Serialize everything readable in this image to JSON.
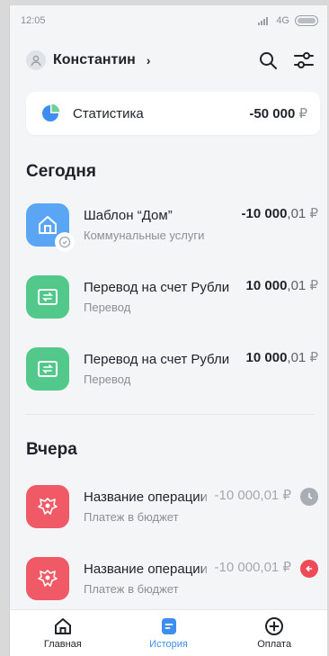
{
  "status_bar": {
    "time": "12:05",
    "network": "4G"
  },
  "header": {
    "user_name": "Константин",
    "chevron": "›"
  },
  "stats": {
    "label": "Статистика",
    "amount": "-50 000",
    "currency": "₽"
  },
  "sections": {
    "today": "Сегодня",
    "yesterday": "Вчера"
  },
  "transactions_today": [
    {
      "title": "Шаблон “Дом”",
      "subtitle": "Коммунальные услуги",
      "amount_int": "-10 000",
      "amount_frac": ",01",
      "currency": "₽",
      "icon": "house-icon",
      "badge": "clock-badge-icon",
      "color": "#5aa6f5"
    },
    {
      "title": "Перевод на счет Рубли",
      "subtitle": "Перевод",
      "amount_int": "10 000",
      "amount_frac": ",01",
      "currency": "₽",
      "icon": "transfer-icon",
      "color": "#52c98a"
    },
    {
      "title": "Перевод на счет Рубли",
      "subtitle": "Перевод",
      "amount_int": "10 000",
      "amount_frac": ",01",
      "currency": "₽",
      "icon": "transfer-icon",
      "color": "#52c98a"
    }
  ],
  "transactions_yesterday": [
    {
      "title": "Название операции",
      "subtitle": "Платеж в бюджет",
      "amount_int": "-10 000",
      "amount_frac": ",01",
      "currency": "₽",
      "icon": "eagle-emblem-icon",
      "status": "clock-status-icon",
      "color": "#ef5a66",
      "status_color": "#a9aeb4"
    },
    {
      "title": "Название операции",
      "subtitle": "Платеж в бюджет",
      "amount_int": "-10 000",
      "amount_frac": ",01",
      "currency": "₽",
      "icon": "eagle-emblem-icon",
      "status": "error-status-icon",
      "color": "#ef5a66",
      "status_color": "#ef4a57"
    }
  ],
  "tabs": [
    {
      "label": "Главная",
      "icon": "home-icon"
    },
    {
      "label": "История",
      "icon": "history-icon",
      "active": true
    },
    {
      "label": "Оплата",
      "icon": "plus-circle-icon"
    }
  ],
  "colors": {
    "accent": "#3d8ef0",
    "text": "#1f2329",
    "muted": "#8b8f96"
  }
}
